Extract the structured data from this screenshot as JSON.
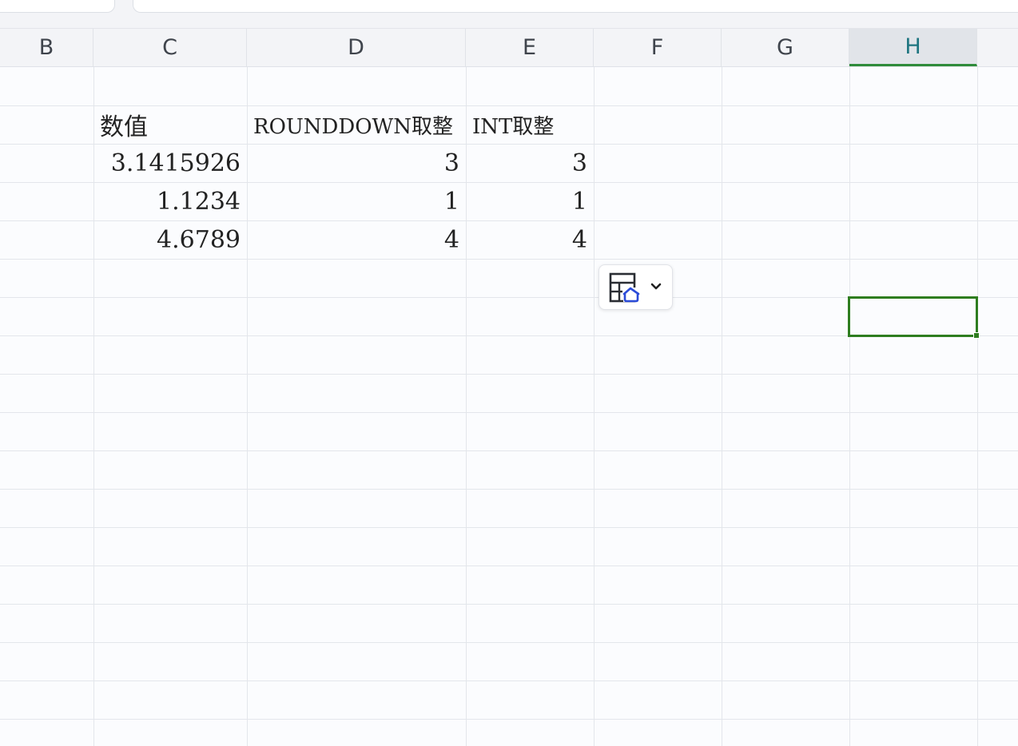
{
  "columns": [
    "B",
    "C",
    "D",
    "E",
    "F",
    "G",
    "H"
  ],
  "selected_column": "H",
  "cells": {
    "c2": "数值",
    "d2": "ROUNDDOWN取整",
    "e2": "INT取整",
    "c3": "3.1415926",
    "d3": "3",
    "e3": "3",
    "c4": "1.1234",
    "d4": "1",
    "e4": "1",
    "c5": "4.6789",
    "d5": "4",
    "e5": "4"
  },
  "paste_options": {
    "icon": "paste-options-icon",
    "dropdown_icon": "chevron-down-icon"
  },
  "colors": {
    "selection": "#2e7d1f",
    "selected_header_text": "#1e7580",
    "icon_blue": "#2b4bd8"
  }
}
